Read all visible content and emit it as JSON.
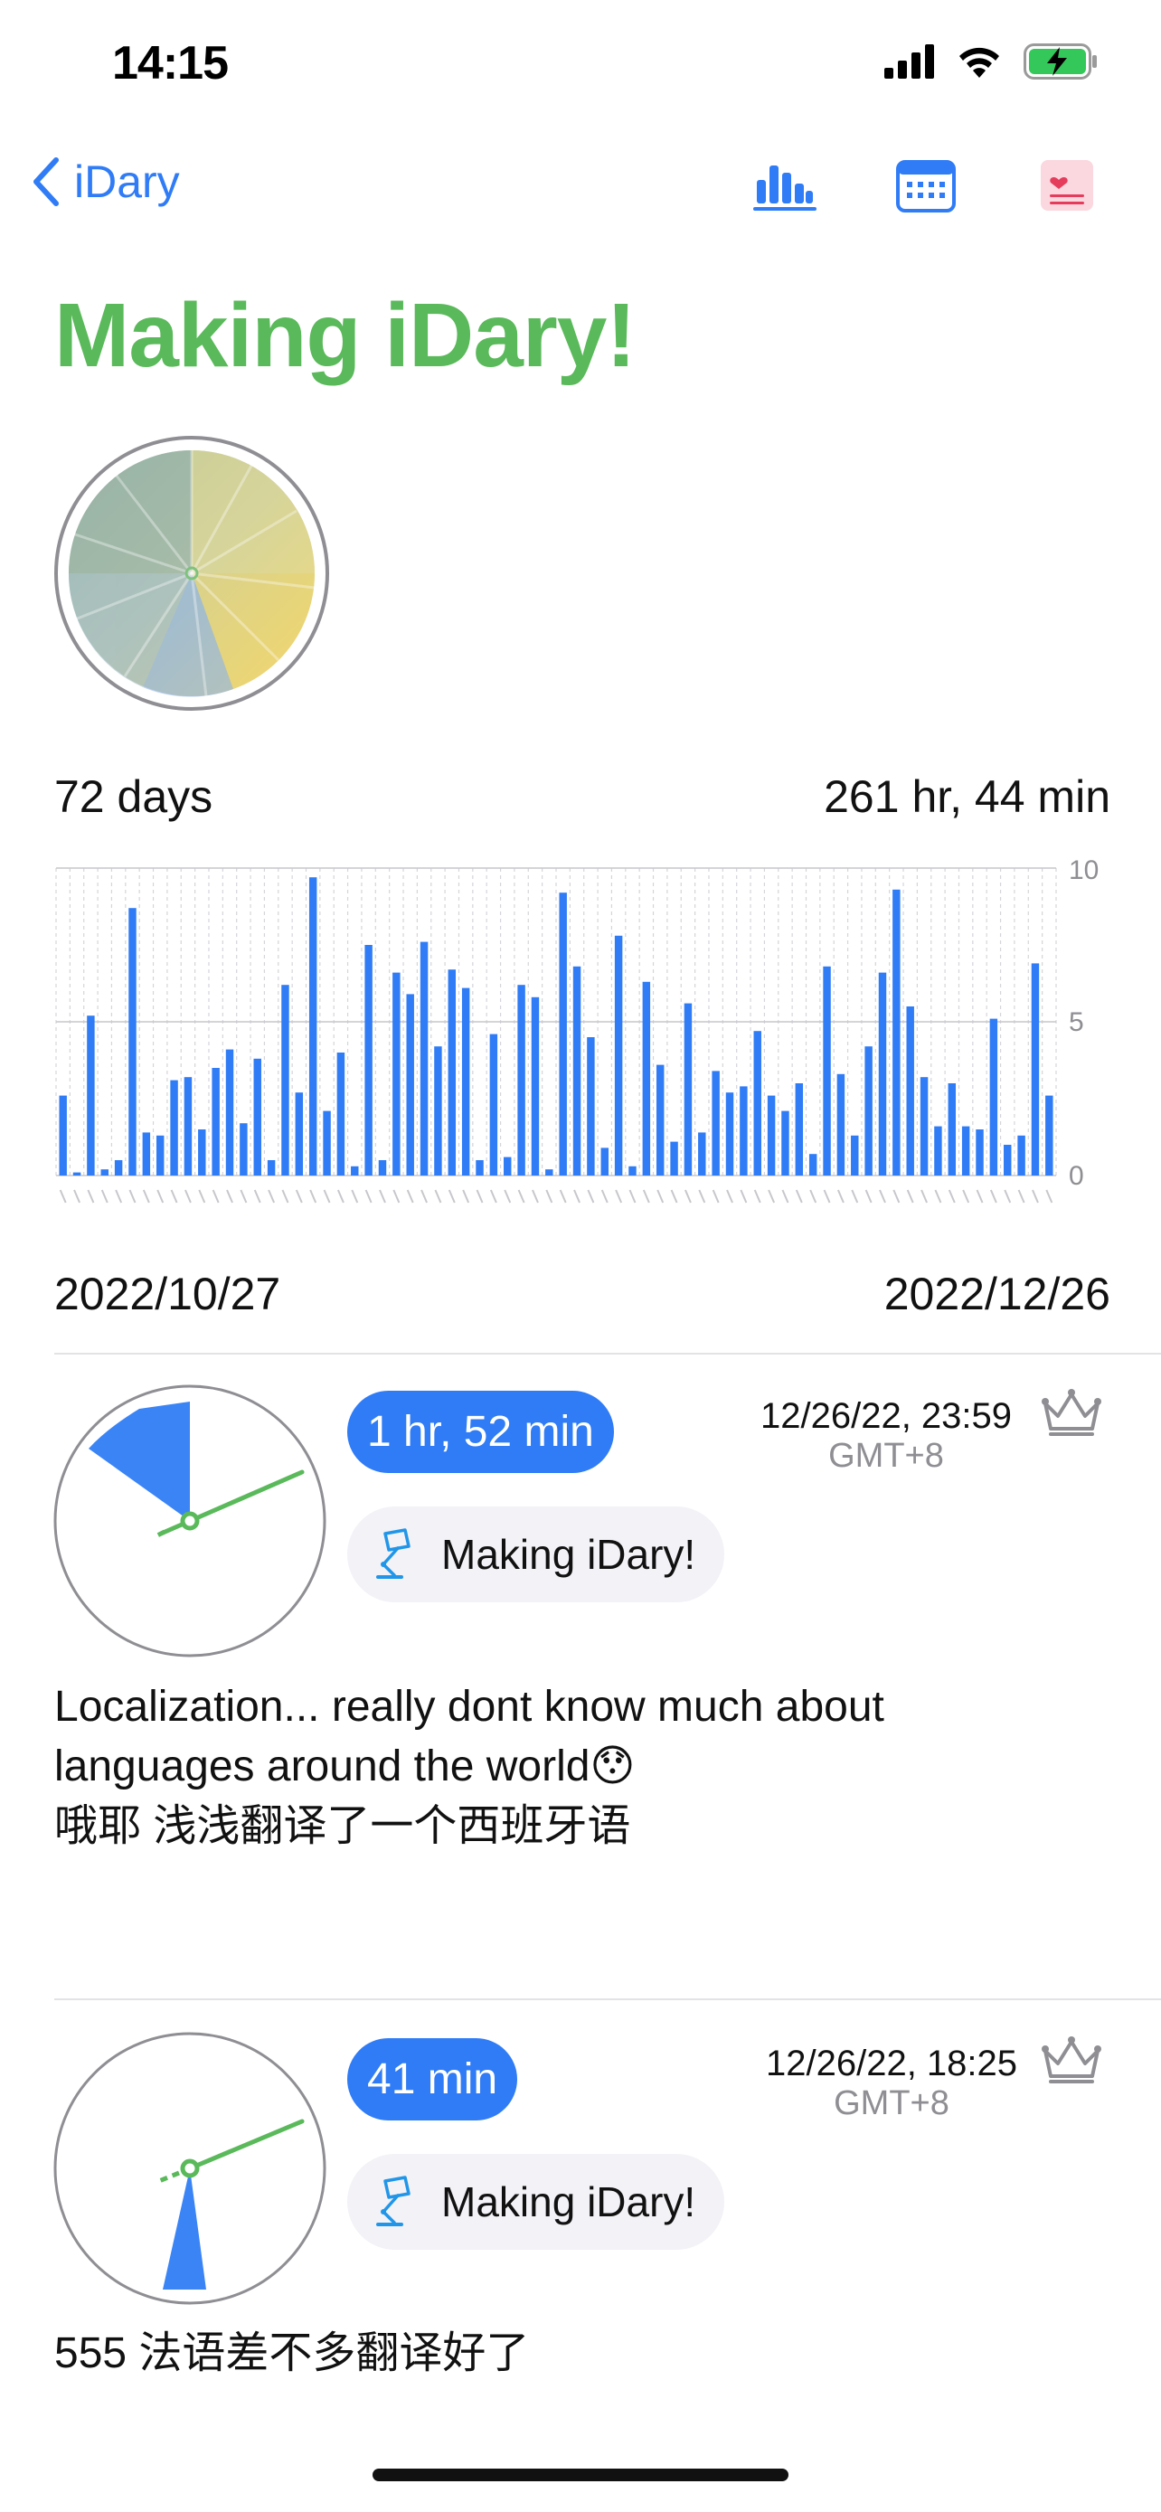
{
  "status_bar": {
    "time": "14:15",
    "icons": [
      "cellular-signal-icon",
      "wifi-icon",
      "battery-charging-icon"
    ]
  },
  "nav": {
    "back_label": "iDary",
    "icons": [
      "bar-chart-icon",
      "calendar-icon",
      "heart-note-icon"
    ],
    "accent_color": "#2f7cf6"
  },
  "project": {
    "title": "Making iDary!",
    "title_color": "#5ab95a"
  },
  "summary": {
    "days": "72 days",
    "total_time": "261 hr, 44 min",
    "start_date": "2022/10/27",
    "end_date": "2022/12/26"
  },
  "chart_data": {
    "type": "bar",
    "ylim": [
      0,
      10
    ],
    "y_ticks": [
      "10",
      "5",
      "0"
    ],
    "grid": true,
    "bar_color": "#2f7cf6",
    "values": [
      2.6,
      0.1,
      5.2,
      0.2,
      0.5,
      8.7,
      1.4,
      1.3,
      3.1,
      3.2,
      1.5,
      3.5,
      4.1,
      1.7,
      3.8,
      0.5,
      6.2,
      2.7,
      9.7,
      2.1,
      4.0,
      0.3,
      7.5,
      0.5,
      6.6,
      5.9,
      7.6,
      4.2,
      6.7,
      6.1,
      0.5,
      4.6,
      0.6,
      6.2,
      5.8,
      0.2,
      9.2,
      6.8,
      4.5,
      0.9,
      7.8,
      0.3,
      6.3,
      3.6,
      1.1,
      5.6,
      1.4,
      3.4,
      2.7,
      2.9,
      4.7,
      2.6,
      2.1,
      3.0,
      0.7,
      6.8,
      3.3,
      1.3,
      4.2,
      6.6,
      9.3,
      5.5,
      3.2,
      1.6,
      3.0,
      1.6,
      1.5,
      5.1,
      1.0,
      1.3,
      6.9,
      2.6
    ]
  },
  "entries": [
    {
      "duration": "1 hr, 52 min",
      "project": "Making iDary!",
      "date": "12/26/22, 23:59",
      "timezone": "GMT+8",
      "note_line1": "Localization... really dont know much about",
      "note_line2": "languages around the world😯",
      "note_line3": "哦耶 浅浅翻译了一个西班牙语"
    },
    {
      "duration": "41 min",
      "project": "Making iDary!",
      "date": "12/26/22, 18:25",
      "timezone": "GMT+8",
      "note_line1": "555  法语差不多翻译好了"
    }
  ]
}
